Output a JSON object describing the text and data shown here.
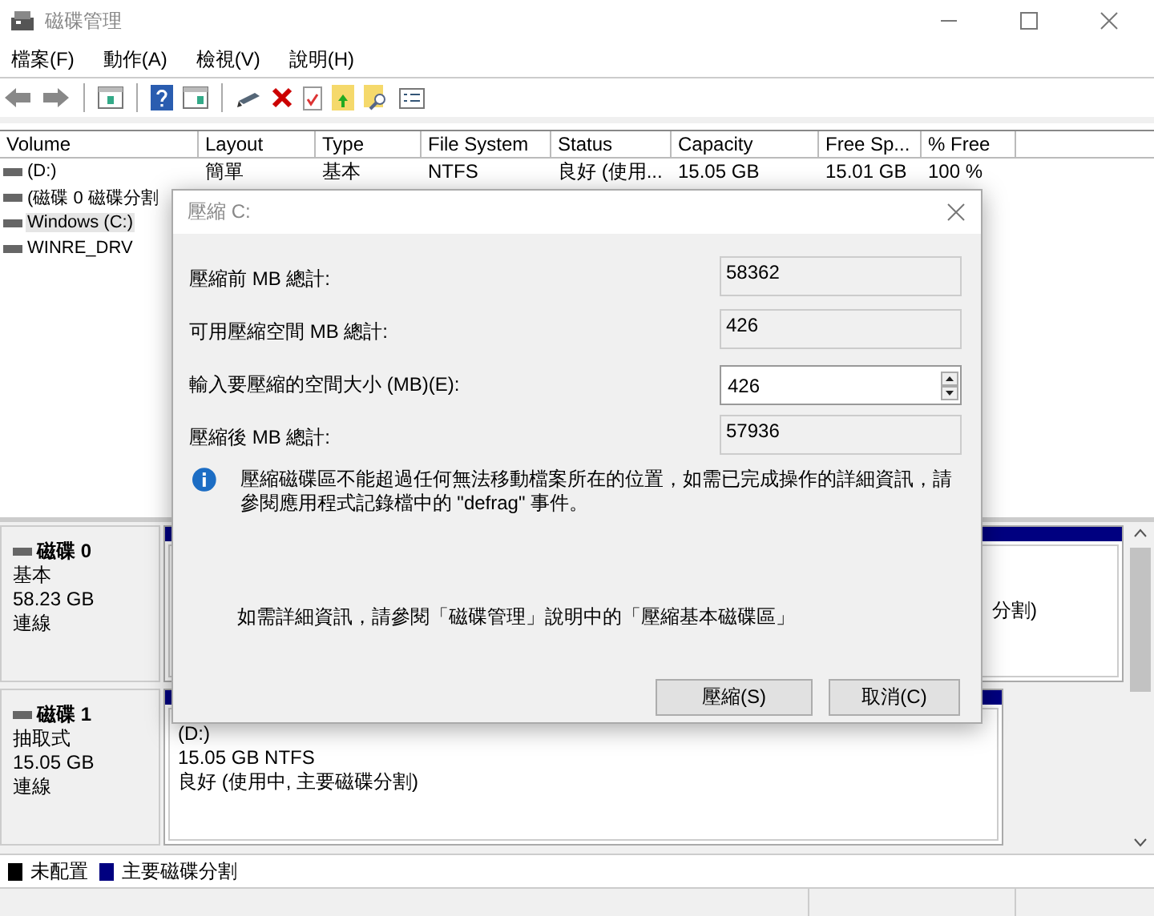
{
  "window": {
    "title": "磁碟管理"
  },
  "menu": [
    "檔案(F)",
    "動作(A)",
    "檢視(V)",
    "說明(H)"
  ],
  "volumes": {
    "columns": [
      "Volume",
      "Layout",
      "Type",
      "File System",
      "Status",
      "Capacity",
      "Free Sp...",
      "% Free"
    ],
    "rows": [
      {
        "cells": [
          "(D:)",
          "簡單",
          "基本",
          "NTFS",
          "良好 (使用...",
          "15.05 GB",
          "15.01 GB",
          "100 %"
        ],
        "selected": false
      },
      {
        "cells": [
          "(磁碟 0 磁碟分割"
        ],
        "selected": false
      },
      {
        "cells": [
          "Windows (C:)"
        ],
        "selected": true
      },
      {
        "cells": [
          "WINRE_DRV"
        ],
        "selected": false
      }
    ]
  },
  "disks": [
    {
      "name": "磁碟 0",
      "type": "基本",
      "size": "58.23 GB",
      "status": "連線",
      "partitions": [
        {
          "color": "#000080",
          "lines": [
            "分割)"
          ]
        }
      ]
    },
    {
      "name": "磁碟 1",
      "type": "抽取式",
      "size": "15.05 GB",
      "status": "連線",
      "partitions": [
        {
          "color": "#000080",
          "lines": [
            "(D:)",
            "15.05 GB NTFS",
            "良好 (使用中, 主要磁碟分割)"
          ]
        }
      ]
    }
  ],
  "legend": [
    {
      "label": "未配置",
      "color": "#000000"
    },
    {
      "label": "主要磁碟分割",
      "color": "#000080"
    }
  ],
  "dialog": {
    "title": "壓縮 C:",
    "fields": [
      {
        "label": "壓縮前 MB 總計:",
        "value": "58362",
        "kind": "readonly"
      },
      {
        "label": "可用壓縮空間 MB 總計:",
        "value": "426",
        "kind": "readonly"
      },
      {
        "label": "輸入要壓縮的空間大小 (MB)(E):",
        "value": "426",
        "kind": "spin"
      },
      {
        "label": "壓縮後 MB 總計:",
        "value": "57936",
        "kind": "readonly"
      }
    ],
    "info": "壓縮磁碟區不能超過任何無法移動檔案所在的位置，如需已完成操作的詳細資訊，請參閱應用程式記錄檔中的 \"defrag\" 事件。",
    "help": "如需詳細資訊，請參閱「磁碟管理」說明中的「壓縮基本磁碟區」",
    "buttons": [
      "壓縮(S)",
      "取消(C)"
    ]
  }
}
